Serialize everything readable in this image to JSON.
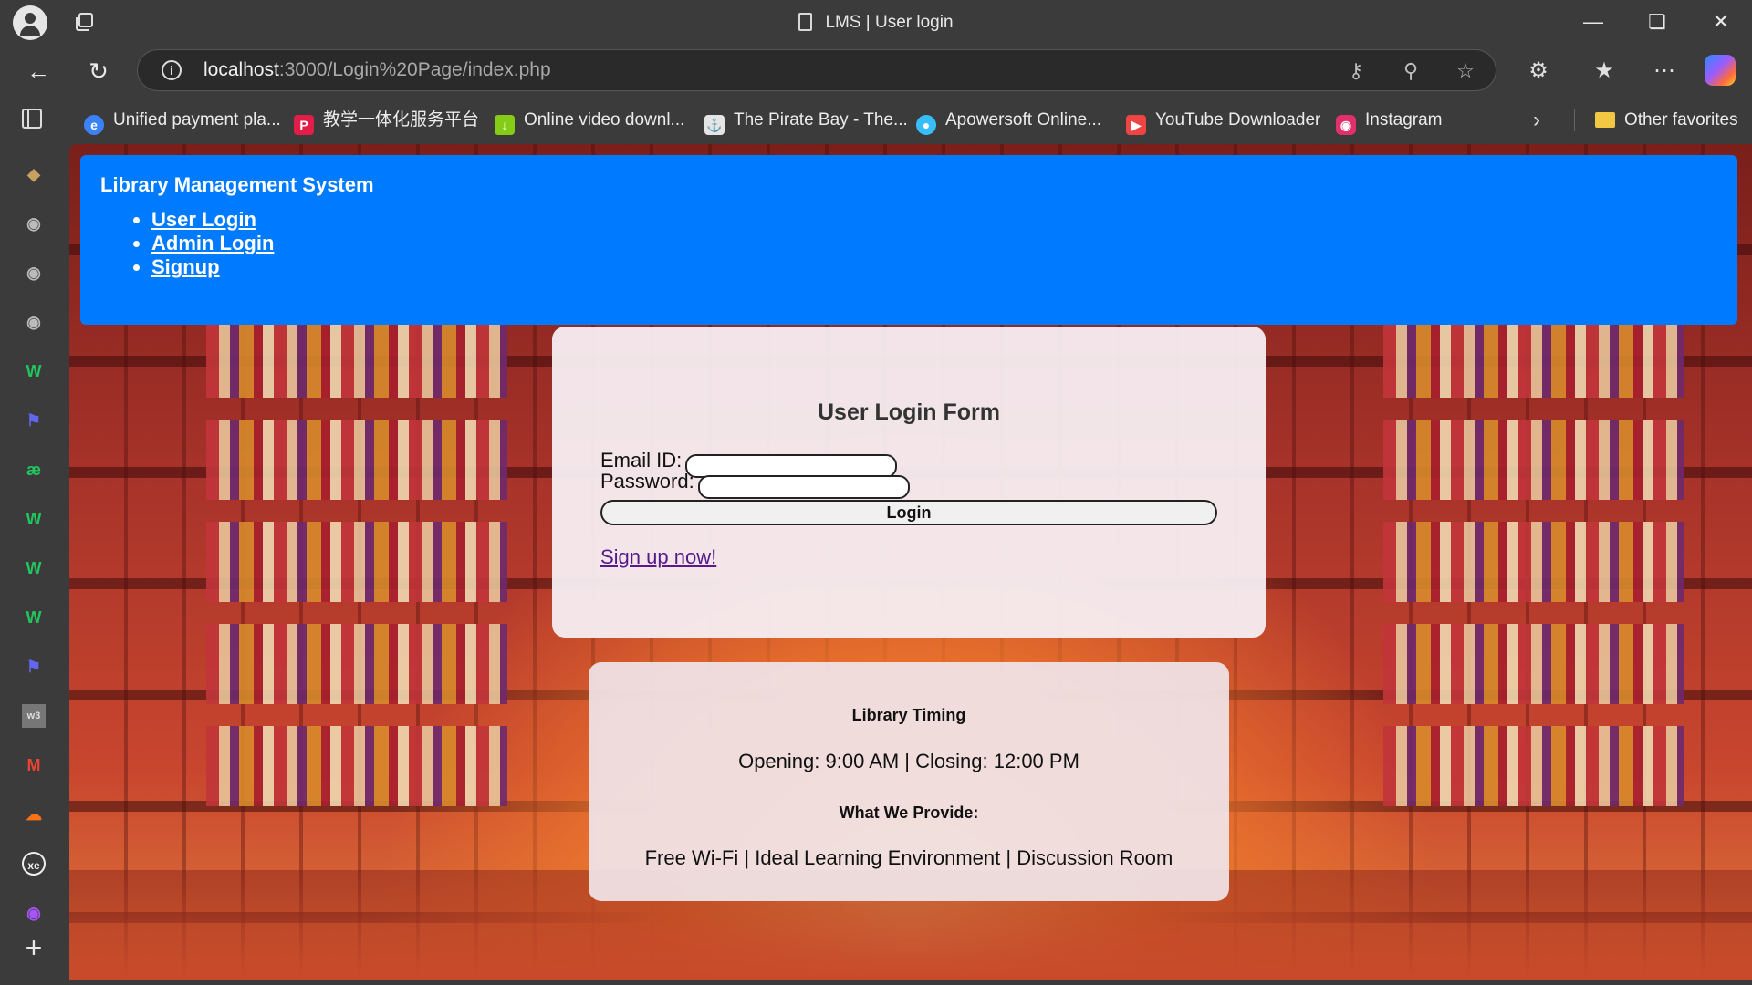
{
  "window": {
    "title": "LMS | User login"
  },
  "address_bar": {
    "host": "localhost",
    "rest": ":3000/Login%20Page/index.php"
  },
  "bookmarks": [
    {
      "label": "Unified payment pla...",
      "icon": "payment-icon",
      "color": "#3b82f6"
    },
    {
      "label": "教学一体化服务平台",
      "icon": "p-logo-icon",
      "color": "#e11d48"
    },
    {
      "label": "Online video downl...",
      "icon": "download-arrow-icon",
      "color": "#84cc16"
    },
    {
      "label": "The Pirate Bay - The...",
      "icon": "pirate-ship-icon",
      "color": "#e5e5e5"
    },
    {
      "label": "Apowersoft Online...",
      "icon": "apowersoft-icon",
      "color": "#38bdf8"
    },
    {
      "label": "YouTube Downloader",
      "icon": "youtube-icon",
      "color": "#ef4444"
    },
    {
      "label": "Instagram",
      "icon": "instagram-icon",
      "color": "#e1306c"
    }
  ],
  "other_favorites": "Other favorites",
  "site": {
    "title": "Library Management System",
    "nav": [
      "User Login",
      "Admin Login",
      "Signup"
    ]
  },
  "login_form": {
    "title": "User Login Form",
    "email_label": "Email ID:",
    "password_label": "Password:",
    "email_value": "",
    "password_value": "",
    "login_button": "Login",
    "signup_link": "Sign up now!"
  },
  "info": {
    "timing_heading": "Library Timing",
    "timing_text": "Opening: 9:00 AM | Closing: 12:00 PM",
    "provide_heading": "What We Provide:",
    "provide_text": "Free Wi-Fi | Ideal Learning Environment | Discussion Room"
  },
  "colors": {
    "header_blue": "#007bff",
    "chrome": "#3b3b3b"
  }
}
